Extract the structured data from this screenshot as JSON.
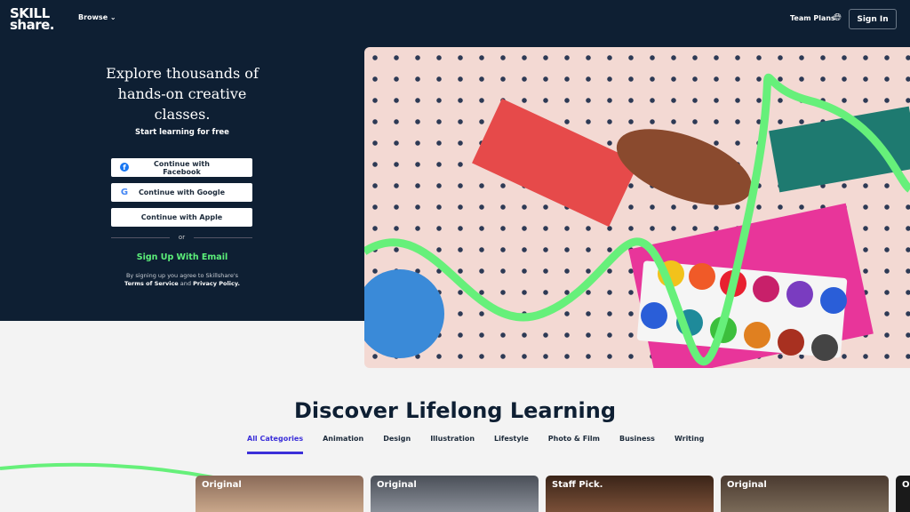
{
  "nav": {
    "logo": "SKILL share.",
    "browse": "Browse",
    "team_plans": "Team Plans",
    "sign_in": "Sign In"
  },
  "hero": {
    "title": "Explore thousands of hands-on creative classes.",
    "subtitle": "Start learning for free",
    "buttons": [
      {
        "label": "Continue with Facebook",
        "icon": "facebook-icon"
      },
      {
        "label": "Continue with Google",
        "icon": "google-icon"
      },
      {
        "label": "Continue with Apple",
        "icon": "apple-icon"
      }
    ],
    "or": "or",
    "email": "Sign Up With Email",
    "terms_prefix": "By signing up you agree to Skillshare's",
    "terms": "Terms of Service",
    "and": "and",
    "privacy": "Privacy Policy."
  },
  "discover": {
    "title": "Discover Lifelong Learning",
    "tabs": [
      "All Categories",
      "Animation",
      "Design",
      "Illustration",
      "Lifestyle",
      "Photo & Film",
      "Business",
      "Writing"
    ],
    "cards": [
      "Original",
      "Original",
      "Staff Pick.",
      "Original",
      "O"
    ]
  },
  "colors": {
    "navy": "#0e1f33",
    "green": "#5cf07a",
    "accent": "#3b2fd9"
  }
}
